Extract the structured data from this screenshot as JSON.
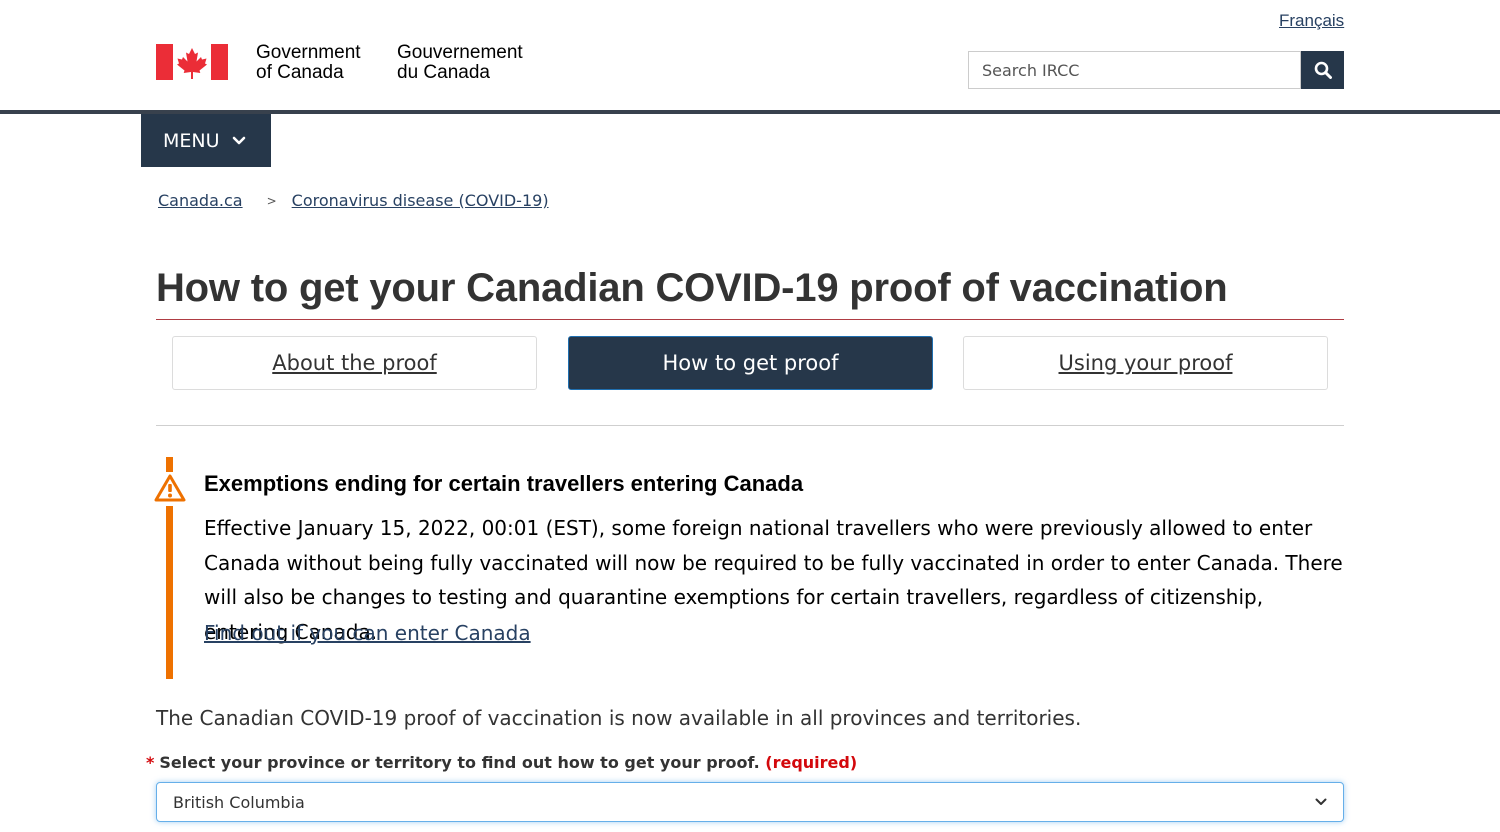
{
  "header": {
    "language_link": "Français",
    "gov_en_line1": "Government",
    "gov_en_line2": "of Canada",
    "gov_fr_line1": "Gouvernement",
    "gov_fr_line2": "du Canada",
    "search_placeholder": "Search IRCC",
    "search_icon": "search-icon",
    "menu_label": "MENU",
    "colors": {
      "flag_red": "#eb2d37",
      "nav_dark": "#26374a"
    }
  },
  "breadcrumb": {
    "items": [
      {
        "label": "Canada.ca"
      },
      {
        "label": "Coronavirus disease (COVID-19)"
      }
    ],
    "separator": ">"
  },
  "page": {
    "title": "How to get your Canadian COVID-19 proof of vaccination",
    "tabs": [
      {
        "label": "About the proof",
        "active": false
      },
      {
        "label": "How to get proof",
        "active": true
      },
      {
        "label": "Using your proof",
        "active": false
      }
    ]
  },
  "alert": {
    "icon": "warning-icon",
    "accent_color": "#ee7100",
    "heading": "Exemptions ending for certain travellers entering Canada",
    "body": "Effective January 15, 2022, 00:01 (EST), some foreign national travellers who were previously allowed to enter Canada without being fully vaccinated will now be required to be fully vaccinated in order to enter Canada. There will also be changes to testing and quarantine exemptions for certain travellers, regardless of citizenship, entering Canada.",
    "link": "Find out if you can enter Canada"
  },
  "intro": "The Canadian COVID-19 proof of vaccination is now available in all provinces and territories.",
  "form": {
    "required_marker": "*",
    "label": "Select your province or territory to find out how to get your proof.",
    "required_text": "(required)",
    "selected_value": "British Columbia"
  }
}
